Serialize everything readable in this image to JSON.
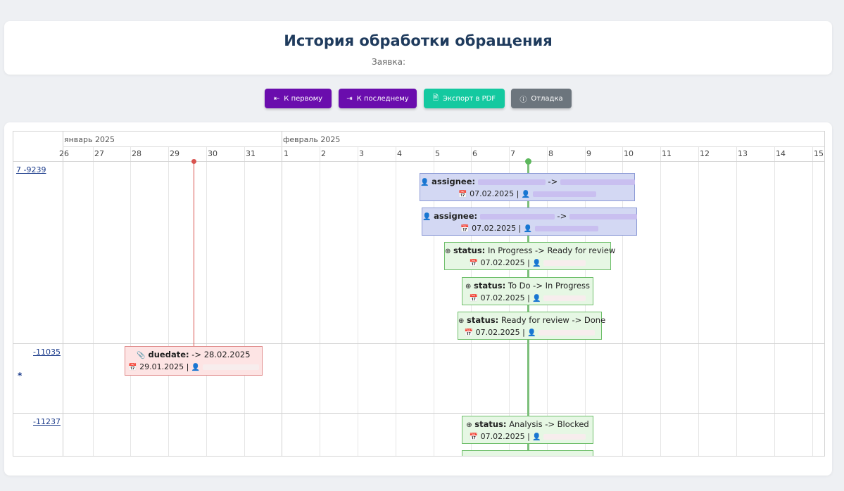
{
  "header": {
    "title": "История обработки обращения",
    "subtitle": "Заявка:"
  },
  "toolbar": {
    "first_label": "К первому",
    "last_label": "К последнему",
    "pdf_label": "Экспорт в PDF",
    "debug_label": "Отладка",
    "colors": {
      "first": "#6a0dad",
      "last": "#6a0dad",
      "pdf": "#14c9a0",
      "debug": "#6c757d"
    }
  },
  "timeline": {
    "months": [
      "январь 2025",
      "февраль 2025"
    ],
    "days": [
      "26",
      "27",
      "28",
      "29",
      "30",
      "31",
      "1",
      "2",
      "3",
      "4",
      "5",
      "6",
      "7",
      "8",
      "9",
      "10",
      "11",
      "12",
      "13",
      "14",
      "15"
    ],
    "groups": [
      {
        "label": "7  -9239"
      },
      {
        "label": "-11035",
        "star": "*"
      },
      {
        "label": "-11237"
      }
    ],
    "items": [
      {
        "field": "assignee:",
        "change": " -> ",
        "date": "07.02.2025 | ",
        "color": "blue"
      },
      {
        "field": "assignee:",
        "change": " -> ",
        "date": "07.02.2025 | ",
        "color": "blue"
      },
      {
        "field": "status:",
        "change": "In Progress -> Ready for review",
        "date": "07.02.2025 | ",
        "color": "green"
      },
      {
        "field": "status:",
        "change": "To Do -> In Progress",
        "date": "07.02.2025 | ",
        "color": "green"
      },
      {
        "field": "status:",
        "change": "Ready for review -> Done",
        "date": "07.02.2025 | ",
        "color": "green"
      },
      {
        "field": "duedate:",
        "change": "-> 28.02.2025",
        "date": "29.01.2025 | ",
        "color": "red"
      },
      {
        "field": "status:",
        "change": "Analysis -> Blocked",
        "date": "07.02.2025 | ",
        "color": "green"
      }
    ],
    "marker_colors": {
      "red": "#d9534f",
      "green": "#5cb85c"
    }
  }
}
